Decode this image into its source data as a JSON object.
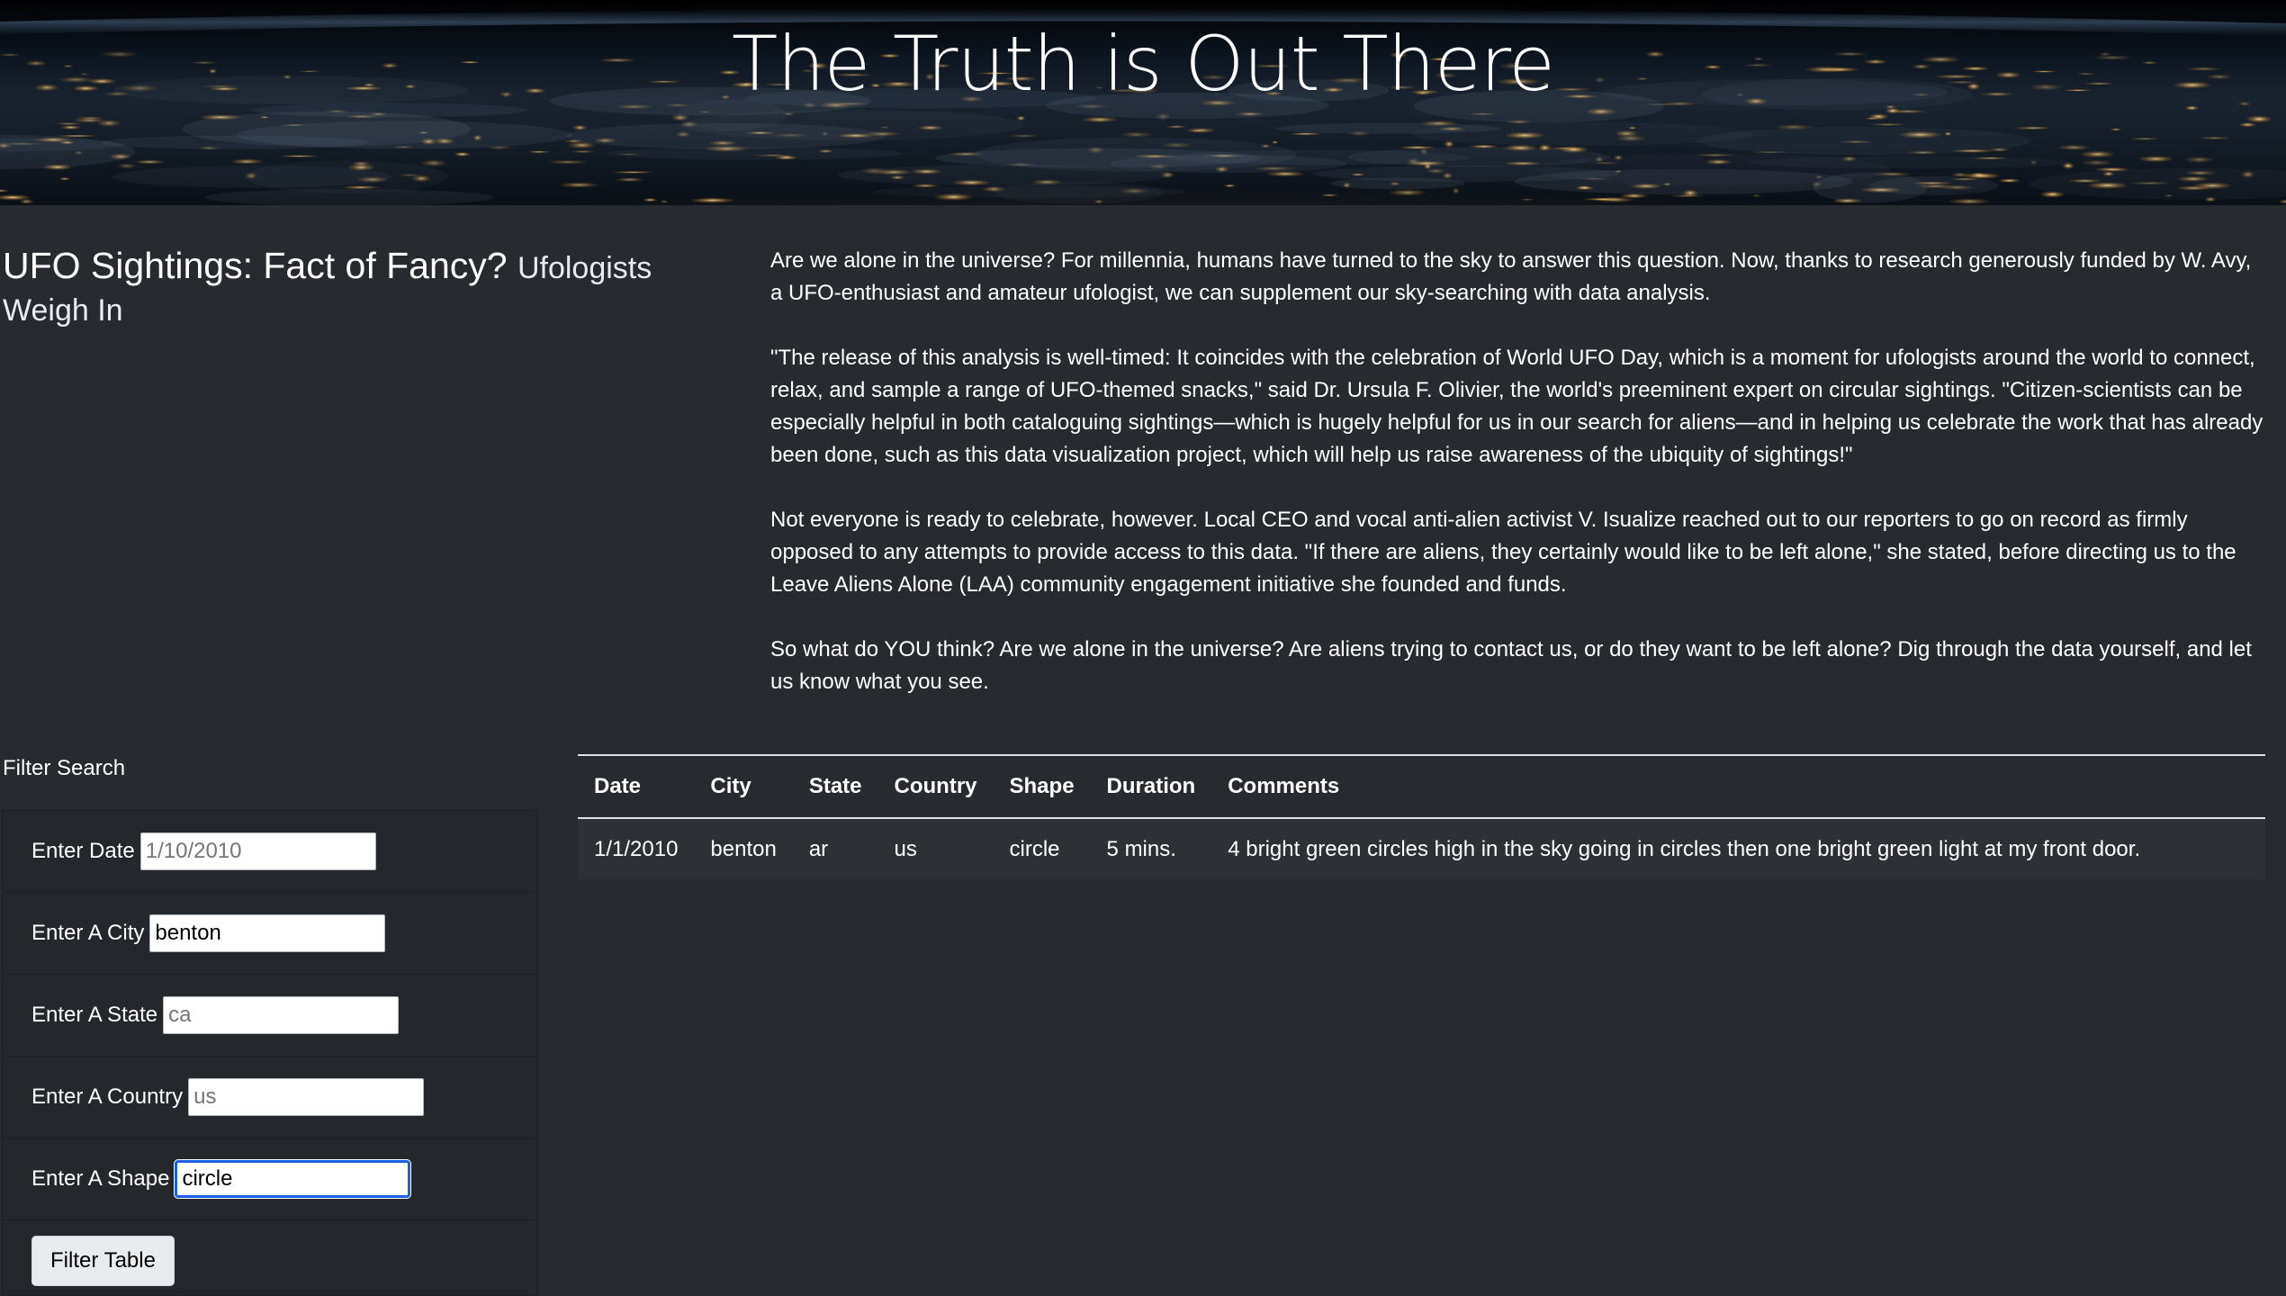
{
  "header": {
    "title": "The Truth is Out There"
  },
  "heading": {
    "main": "UFO Sightings: Fact of Fancy?",
    "sub": "Ufologists Weigh In"
  },
  "article": {
    "paragraphs": [
      "Are we alone in the universe? For millennia, humans have turned to the sky to answer this question. Now, thanks to research generously funded by W. Avy, a UFO-enthusiast and amateur ufologist, we can supplement our sky-searching with data analysis.",
      "\"The release of this analysis is well-timed: It coincides with the celebration of World UFO Day, which is a moment for ufologists around the world to connect, relax, and sample a range of UFO-themed snacks,\" said Dr. Ursula F. Olivier, the world's preeminent expert on circular sightings. \"Citizen-scientists can be especially helpful in both cataloguing sightings—which is hugely helpful for us in our search for aliens—and in helping us celebrate the work that has already been done, such as this data visualization project, which will help us raise awareness of the ubiquity of sightings!\"",
      "Not everyone is ready to celebrate, however. Local CEO and vocal anti-alien activist V. Isualize reached out to our reporters to go on record as firmly opposed to any attempts to provide access to this data. \"If there are aliens, they certainly would like to be left alone,\" she stated, before directing us to the Leave Aliens Alone (LAA) community engagement initiative she founded and funds.",
      "So what do YOU think? Are we alone in the universe? Are aliens trying to contact us, or do they want to be left alone? Dig through the data yourself, and let us know what you see."
    ]
  },
  "filters": {
    "title": "Filter Search",
    "date": {
      "label": "Enter Date",
      "value": "",
      "placeholder": "1/10/2010"
    },
    "city": {
      "label": "Enter A City",
      "value": "benton",
      "placeholder": ""
    },
    "state": {
      "label": "Enter A State",
      "value": "",
      "placeholder": "ca"
    },
    "country": {
      "label": "Enter A Country",
      "value": "",
      "placeholder": "us"
    },
    "shape": {
      "label": "Enter A Shape",
      "value": "circle",
      "placeholder": ""
    },
    "button_label": "Filter Table"
  },
  "table": {
    "columns": [
      "Date",
      "City",
      "State",
      "Country",
      "Shape",
      "Duration",
      "Comments"
    ],
    "rows": [
      [
        "1/1/2010",
        "benton",
        "ar",
        "us",
        "circle",
        "5 mins.",
        "4 bright green circles high in the sky going in circles then one bright green light at my front door."
      ]
    ]
  }
}
